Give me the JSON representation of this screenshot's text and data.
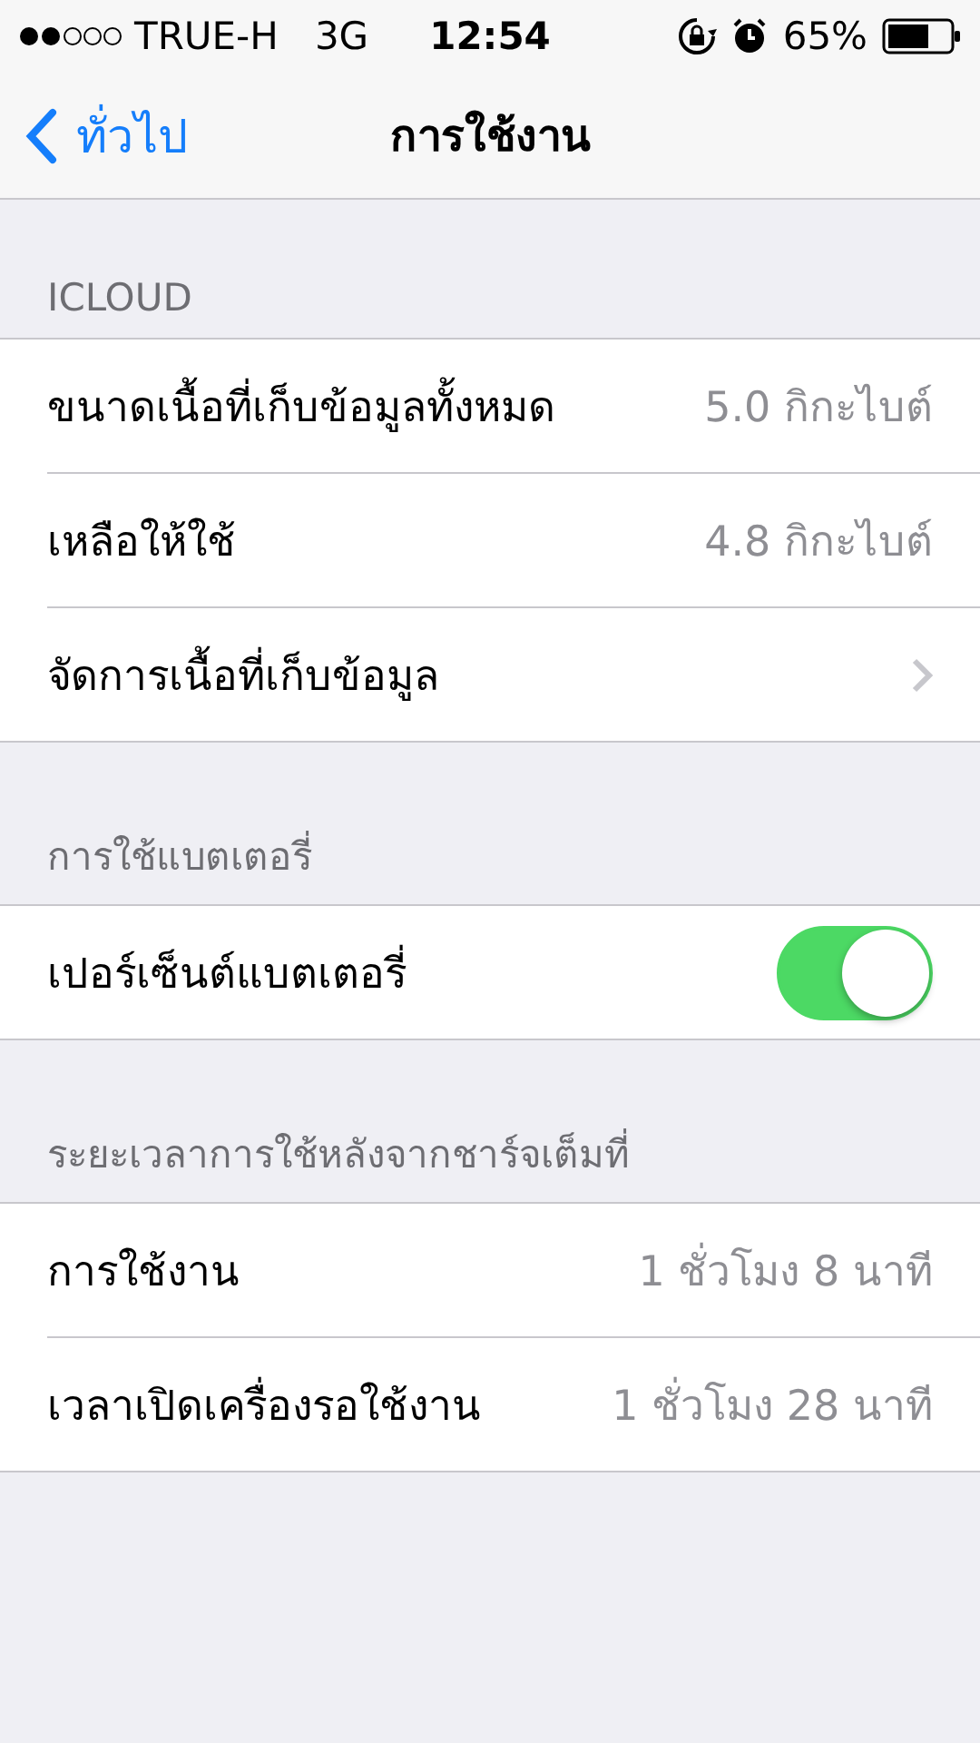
{
  "status_bar": {
    "carrier": "TRUE-H",
    "network": "3G",
    "time": "12:54",
    "battery_percent": "65%"
  },
  "nav": {
    "back": "ทั่วไป",
    "title": "การใช้งาน"
  },
  "sections": [
    {
      "header": "ICLOUD",
      "rows": [
        {
          "kind": "value",
          "label": "ขนาดเนื้อที่เก็บข้อมูลทั้งหมด",
          "value": "5.0 กิกะไบต์"
        },
        {
          "kind": "value",
          "label": "เหลือให้ใช้",
          "value": "4.8 กิกะไบต์"
        },
        {
          "kind": "disclosure",
          "label": "จัดการเนื้อที่เก็บข้อมูล"
        }
      ]
    },
    {
      "header": "การใช้แบตเตอรี่",
      "rows": [
        {
          "kind": "toggle",
          "label": "เปอร์เซ็นต์แบตเตอรี่",
          "on": true
        }
      ]
    },
    {
      "header": "ระยะเวลาการใช้หลังจากชาร์จเต็มที่",
      "rows": [
        {
          "kind": "value",
          "label": "การใช้งาน",
          "value": "1 ชั่วโมง 8 นาที"
        },
        {
          "kind": "value",
          "label": "เวลาเปิดเครื่องรอใช้งาน",
          "value": "1 ชั่วโมง 28 นาที"
        }
      ]
    }
  ]
}
